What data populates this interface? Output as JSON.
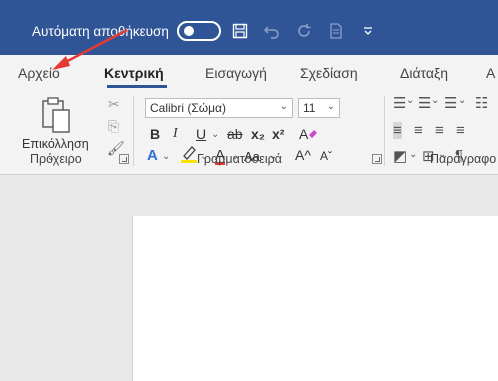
{
  "titlebar": {
    "autosave_label": "Αυτόματη αποθήκευση",
    "autosave_state": "off",
    "icons": [
      "save-icon",
      "undo-icon",
      "redo-icon",
      "document-icon",
      "customize-qat-icon"
    ]
  },
  "tabs": [
    {
      "label": "Αρχείο",
      "active": false
    },
    {
      "label": "Κεντρική",
      "active": true
    },
    {
      "label": "Εισαγωγή",
      "active": false
    },
    {
      "label": "Σχεδίαση",
      "active": false
    },
    {
      "label": "Διάταξη",
      "active": false
    },
    {
      "label": "Α",
      "active": false
    }
  ],
  "ribbon": {
    "clipboard": {
      "paste_label": "Επικόλληση",
      "group_label": "Πρόχειρο"
    },
    "font": {
      "font_name": "Calibri (Σώμα)",
      "font_size": "11",
      "bold": "B",
      "italic": "I",
      "underline": "U",
      "strike": "ab",
      "subscript": "x₂",
      "superscript": "x²",
      "text_effects": "A",
      "font_color": "A",
      "change_case": "Aa",
      "grow": "A^",
      "shrink": "Aˇ",
      "group_label": "Γραμματοσειρά"
    },
    "paragraph": {
      "group_label": "Παράγραφο"
    }
  },
  "colors": {
    "titlebar": "#2f5597",
    "ribbon_bg": "#f3f3f3",
    "annotation_arrow": "#e53935",
    "highlight": "#f5e600",
    "font_color": "#e53935",
    "text_effects": "#2f6fd6"
  }
}
